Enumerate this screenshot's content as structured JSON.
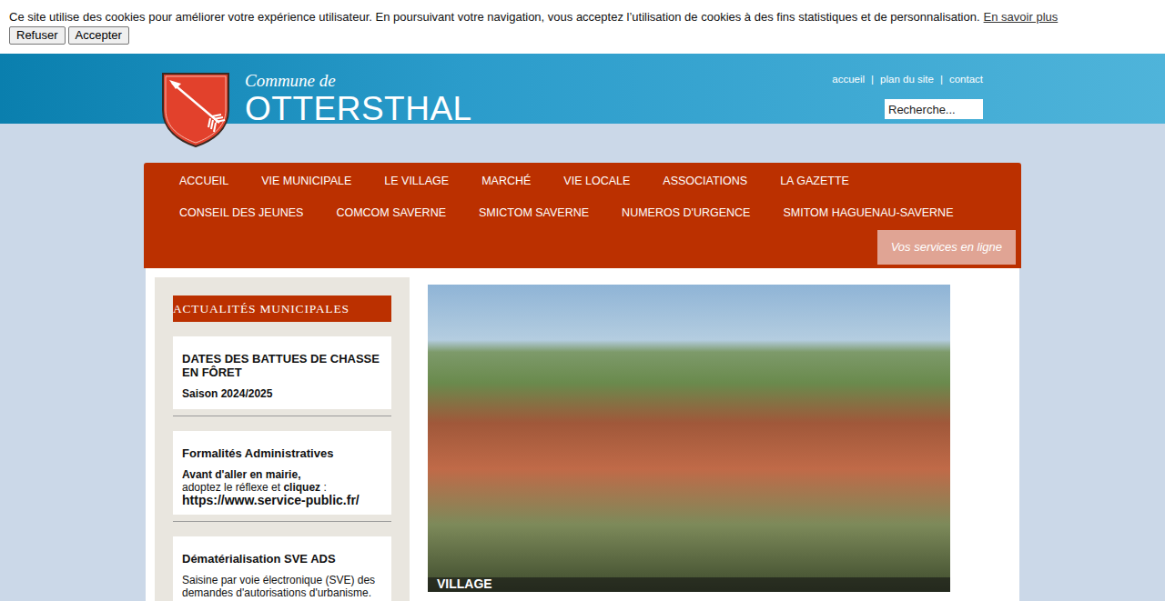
{
  "cookie_bar": {
    "message": "Ce site utilise des cookies pour améliorer votre expérience utilisateur. En poursuivant votre navigation, vous acceptez l’utilisation de cookies à des fins statistiques et de personnalisation.",
    "link": "En savoir plus",
    "buttons": [
      "Refuser",
      "Accepter"
    ]
  },
  "header": {
    "subtitle": "Commune de",
    "title": "OTTERSTHAL",
    "links": [
      "accueil",
      "plan du site",
      "contact"
    ],
    "separator": "|",
    "search": {
      "placeholder": "Recherche..."
    }
  },
  "nav": {
    "items": [
      "ACCUEIL",
      "VIE MUNICIPALE",
      "LE VILLAGE",
      "MARCHÉ",
      "VIE LOCALE",
      "ASSOCIATIONS",
      "LA GAZETTE",
      "CONSEIL DES JEUNES",
      "COMCOM SAVERNE",
      "SMICTOM SAVERNE",
      "NUMEROS D'URGENCE",
      "SMITOM HAGUENAU-SAVERNE"
    ],
    "services_button": "Vos services en ligne"
  },
  "sidebar": {
    "title": "ACTUALITÉS MUNICIPALES",
    "news": [
      {
        "title": "DATES DES BATTUES DE CHASSE EN FÔRET",
        "lines": [
          [
            {
              "text": "Saison 2024/2025",
              "kind": "strong"
            }
          ]
        ]
      },
      {
        "title": "Formalités Administratives",
        "lines": [
          [
            {
              "text": "Avant d'aller en mairie,",
              "kind": "strong"
            }
          ],
          [
            {
              "text": "adoptez le réflexe et ",
              "kind": "plain"
            },
            {
              "text": "cliquez",
              "kind": "strong"
            },
            {
              "text": " :",
              "kind": "plain"
            }
          ],
          [
            {
              "text": "https://www.service-public.fr/",
              "kind": "url"
            }
          ]
        ]
      },
      {
        "title": "Dématérialisation SVE ADS",
        "lines": [
          [
            {
              "text": "Saisine par voie électronique (SVE) des demandes d'autorisations d'urbanisme.",
              "kind": "plain"
            }
          ]
        ]
      }
    ]
  },
  "slider": {
    "caption": "VILLAGE"
  }
}
